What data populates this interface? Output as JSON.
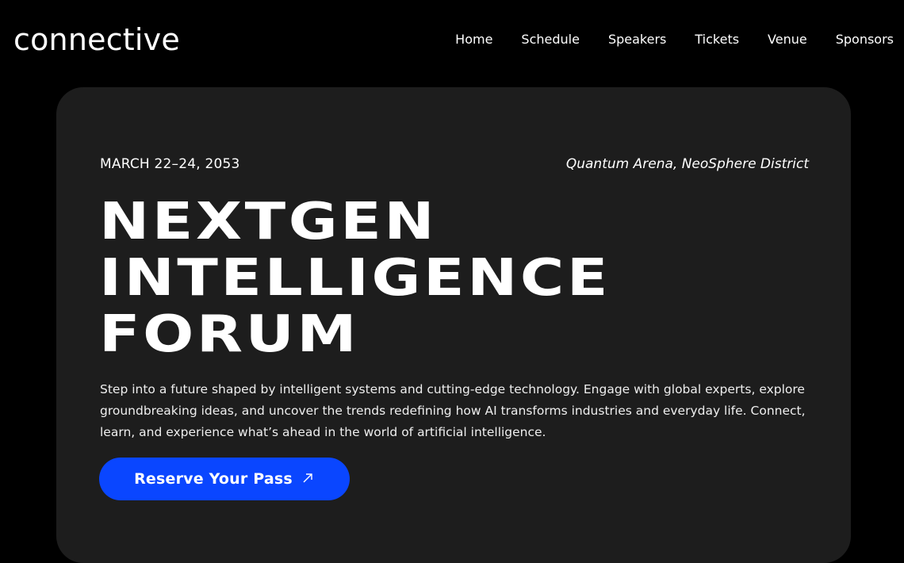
{
  "header": {
    "logo": "connective",
    "nav": [
      {
        "label": "Home"
      },
      {
        "label": "Schedule"
      },
      {
        "label": "Speakers"
      },
      {
        "label": "Tickets"
      },
      {
        "label": "Venue"
      },
      {
        "label": "Sponsors"
      }
    ]
  },
  "hero": {
    "date": "MARCH 22–24, 2053",
    "venue": "Quantum Arena, NeoSphere District",
    "headline_lines": [
      "NEXTGEN",
      "INTELLIGENCE",
      "FORUM"
    ],
    "description": "Step into a future shaped by intelligent systems and cutting-edge technology. Engage with global experts, explore groundbreaking ideas, and uncover the trends redefining how AI transforms industries and everyday life. Connect, learn, and experience what’s ahead in the world of artificial intelligence.",
    "cta_label": "Reserve Your Pass",
    "cta_icon": "arrow-up-right-icon"
  },
  "colors": {
    "page_background": "#000000",
    "card_background": "#1d1d1d",
    "accent": "#0a46ff",
    "text": "#ffffff"
  }
}
